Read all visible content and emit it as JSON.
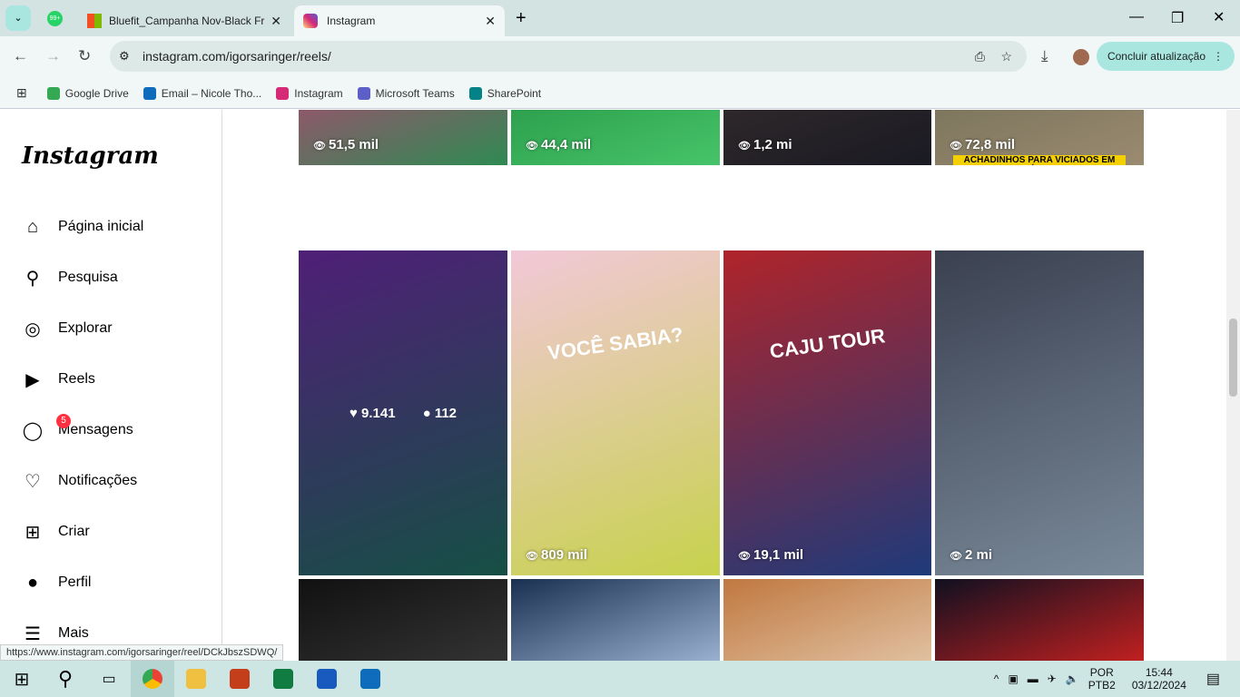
{
  "browser": {
    "tabs": [
      {
        "label": "Bluefit_Campanha Nov-Black Fr",
        "active": false
      },
      {
        "label": "Instagram",
        "active": true
      }
    ],
    "whatsapp_badge": "99+",
    "url": "instagram.com/igorsaringer/reels/",
    "update_label": "Concluir atualização",
    "bookmarks": [
      {
        "label": "Google Drive",
        "color": "#34a853"
      },
      {
        "label": "Email – Nicole Tho...",
        "color": "#0f6cbd"
      },
      {
        "label": "Instagram",
        "color": "#d62976"
      },
      {
        "label": "Microsoft Teams",
        "color": "#5b5fc7"
      },
      {
        "label": "SharePoint",
        "color": "#038387"
      }
    ],
    "status_url": "https://www.instagram.com/igorsaringer/reel/DCkJbszSDWQ/"
  },
  "sidebar": {
    "logo": "Instagram",
    "items": [
      {
        "label": "Página inicial",
        "icon": "home-icon",
        "glyph": "⌂"
      },
      {
        "label": "Pesquisa",
        "icon": "search-icon",
        "glyph": "⚲"
      },
      {
        "label": "Explorar",
        "icon": "compass-icon",
        "glyph": "◎"
      },
      {
        "label": "Reels",
        "icon": "reels-icon",
        "glyph": "▶"
      },
      {
        "label": "Mensagens",
        "icon": "messenger-icon",
        "glyph": "◯",
        "badge": "5"
      },
      {
        "label": "Notificações",
        "icon": "heart-icon",
        "glyph": "♡"
      },
      {
        "label": "Criar",
        "icon": "plus-icon",
        "glyph": "⊞"
      },
      {
        "label": "Perfil",
        "icon": "avatar",
        "glyph": "●"
      },
      {
        "label": "Mais",
        "icon": "menu-icon",
        "glyph": "☰"
      }
    ]
  },
  "reels": [
    {
      "views": "51,5 mil",
      "colors": [
        "#c83a7a",
        "#2e8a52"
      ]
    },
    {
      "views": "44,4 mil",
      "colors": [
        "#1f8a3c",
        "#46c46a"
      ]
    },
    {
      "views": "1,2 mi",
      "colors": [
        "#3a3030",
        "#1a1a22"
      ]
    },
    {
      "views": "72,8 mil",
      "caption": "ACHADINHOS PARA VICIADOS EM MÚSICA",
      "colors": [
        "#6b6a52",
        "#9a8a70"
      ]
    },
    {
      "likes": "9.141",
      "comments": "112",
      "colors": [
        "#6a2aa0",
        "#1d6a5c"
      ]
    },
    {
      "views": "809 mil",
      "caption": "VOCÊ SABIA?",
      "colors": [
        "#f2c8d8",
        "#c7d24c"
      ]
    },
    {
      "views": "19,1 mil",
      "caption": "CAJU TOUR",
      "colors": [
        "#b0242a",
        "#1e3a7a"
      ]
    },
    {
      "views": "2 mi",
      "colors": [
        "#3a4050",
        "#7a8a9a"
      ]
    },
    {
      "colors": [
        "#111",
        "#333"
      ]
    },
    {
      "colors": [
        "#1a3050",
        "#9ab0d0"
      ]
    },
    {
      "colors": [
        "#c07840",
        "#e0c0a0"
      ]
    },
    {
      "colors": [
        "#101020",
        "#c02020"
      ]
    }
  ],
  "taskbar": {
    "lang": "POR",
    "layout": "PTB2",
    "time": "15:44",
    "date": "03/12/2024"
  }
}
